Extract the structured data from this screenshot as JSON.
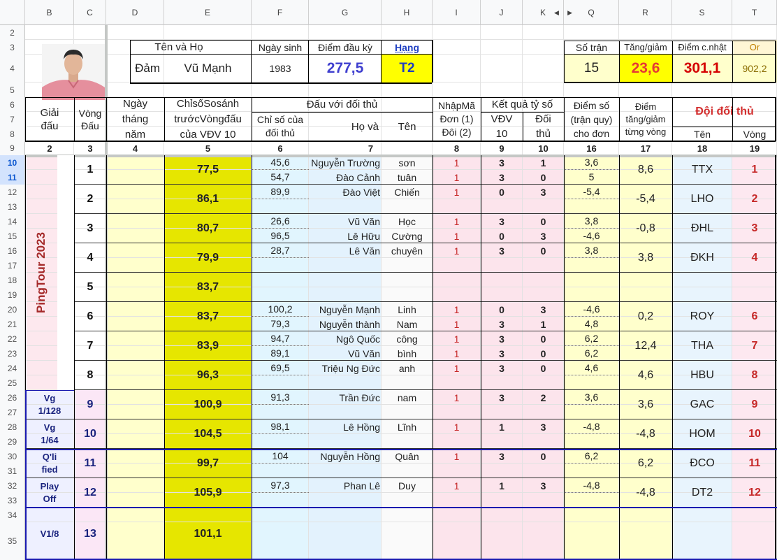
{
  "columns": [
    "B",
    "C",
    "D",
    "E",
    "F",
    "G",
    "H",
    "I",
    "J",
    "K",
    "Q",
    "R",
    "S",
    "T"
  ],
  "rows": [
    "2",
    "3",
    "4",
    "5",
    "6",
    "7",
    "8",
    "9",
    "10",
    "11",
    "12",
    "13",
    "14",
    "15",
    "16",
    "17",
    "18",
    "19",
    "20",
    "21",
    "22",
    "23",
    "24",
    "25",
    "26",
    "27",
    "28",
    "29",
    "30",
    "31",
    "32",
    "33",
    "34",
    "35"
  ],
  "player": {
    "name_header": "Tên    và    Họ",
    "birth_header": "Ngày sinh",
    "start_points_header": "Điểm đầu kỳ",
    "rank_header": "Hạng",
    "first_name": "Đảm",
    "last_name": "Vũ Mạnh",
    "birth": "1983",
    "start_points": "277,5",
    "rank": "T2",
    "photo_icon": "player-photo"
  },
  "summary": {
    "matches_header": "Số trận",
    "change_header": "Tăng/giảm",
    "updated_header": "Điểm c.nhật",
    "or_header": "Or",
    "matches": "15",
    "change": "23,6",
    "updated": "301,1",
    "or_value": "902,2"
  },
  "headers": {
    "tournament": "Giải đấu",
    "round": "Vòng Đấu",
    "date": "Ngày tháng năm",
    "index": "ChỉsốSosánh trướcVòngđấu của VĐV 10",
    "vs_opponent": "Đấu với đối thủ",
    "opp_index": "Chỉ số của đối thủ",
    "opp_last": "Họ    và",
    "opp_first": "Tên",
    "entry_code": "NhậpMã Đơn (1) Đôi (2)",
    "result": "Kết quả tỷ số",
    "vdv10": "VĐV 10",
    "opponent": "Đối thủ",
    "score": "Điểm số (trận quy) cho đơn",
    "change": "Điểm tăng/giảm từng vòng",
    "opp_team": "Đội đối thủ",
    "team_name": "Tên",
    "team_round": "Vòng",
    "num_b": "2",
    "num_c": "3",
    "num_d": "4",
    "num_e": "5",
    "num_f": "6",
    "num_g": "7",
    "num_h": "8",
    "num_i": "9",
    "num_j": "10",
    "num_k": "16",
    "num_q": "17",
    "num_r": "18",
    "num_s": "19"
  },
  "tournament_label": "PingTour 2023",
  "stages": [
    {
      "label": "Vg 1/128"
    },
    {
      "label": "Vg 1/64"
    },
    {
      "label": "Q'li fied"
    },
    {
      "label": "Play Off"
    },
    {
      "label": "V1/8"
    }
  ],
  "rounds": [
    {
      "no": "1",
      "index": "77,5",
      "change": "8,6",
      "team": "TTX",
      "team_round": "1",
      "matches": [
        {
          "opp_index": "45,6",
          "last": "Nguyễn Trường",
          "first": "sơn",
          "code": "1",
          "vdv": "3",
          "opp": "1",
          "score": "3,6"
        },
        {
          "opp_index": "54,7",
          "last": "Đào Cảnh",
          "first": "tuân",
          "code": "1",
          "vdv": "3",
          "opp": "0",
          "score": "5"
        }
      ]
    },
    {
      "no": "2",
      "index": "86,1",
      "change": "-5,4",
      "team": "LHO",
      "team_round": "2",
      "matches": [
        {
          "opp_index": "89,9",
          "last": "Đào Việt",
          "first": "Chiến",
          "code": "1",
          "vdv": "0",
          "opp": "3",
          "score": "-5,4"
        }
      ]
    },
    {
      "no": "3",
      "index": "80,7",
      "change": "-0,8",
      "team": "ĐHL",
      "team_round": "3",
      "matches": [
        {
          "opp_index": "26,6",
          "last": "Vũ Văn",
          "first": "Học",
          "code": "1",
          "vdv": "3",
          "opp": "0",
          "score": "3,8"
        },
        {
          "opp_index": "96,5",
          "last": "Lê Hữu",
          "first": "Cường",
          "code": "1",
          "vdv": "0",
          "opp": "3",
          "score": "-4,6"
        }
      ]
    },
    {
      "no": "4",
      "index": "79,9",
      "change": "3,8",
      "team": "ĐKH",
      "team_round": "4",
      "matches": [
        {
          "opp_index": "28,7",
          "last": "Lê Văn",
          "first": "chuyên",
          "code": "1",
          "vdv": "3",
          "opp": "0",
          "score": "3,8"
        }
      ]
    },
    {
      "no": "5",
      "index": "83,7",
      "change": "",
      "team": "",
      "team_round": "",
      "matches": []
    },
    {
      "no": "6",
      "index": "83,7",
      "change": "0,2",
      "team": "ROY",
      "team_round": "6",
      "matches": [
        {
          "opp_index": "100,2",
          "last": "Nguyễn Mạnh",
          "first": "Linh",
          "code": "1",
          "vdv": "0",
          "opp": "3",
          "score": "-4,6"
        },
        {
          "opp_index": "79,3",
          "last": "Nguyễn thành",
          "first": "Nam",
          "code": "1",
          "vdv": "3",
          "opp": "1",
          "score": "4,8"
        }
      ]
    },
    {
      "no": "7",
      "index": "83,9",
      "change": "12,4",
      "team": "THA",
      "team_round": "7",
      "matches": [
        {
          "opp_index": "94,7",
          "last": "Ngô Quốc",
          "first": "công",
          "code": "1",
          "vdv": "3",
          "opp": "0",
          "score": "6,2"
        },
        {
          "opp_index": "89,1",
          "last": "Vũ Văn",
          "first": "bình",
          "code": "1",
          "vdv": "3",
          "opp": "0",
          "score": "6,2"
        }
      ]
    },
    {
      "no": "8",
      "index": "96,3",
      "change": "4,6",
      "team": "HBU",
      "team_round": "8",
      "matches": [
        {
          "opp_index": "69,5",
          "last": "Triệu Ng Đức",
          "first": "anh",
          "code": "1",
          "vdv": "3",
          "opp": "0",
          "score": "4,6"
        }
      ]
    },
    {
      "no": "9",
      "index": "100,9",
      "change": "3,6",
      "team": "GAC",
      "team_round": "9",
      "matches": [
        {
          "opp_index": "91,3",
          "last": "Trần Đức",
          "first": "nam",
          "code": "1",
          "vdv": "3",
          "opp": "2",
          "score": "3,6"
        }
      ]
    },
    {
      "no": "10",
      "index": "104,5",
      "change": "-4,8",
      "team": "HOM",
      "team_round": "10",
      "matches": [
        {
          "opp_index": "98,1",
          "last": "Lê Hồng",
          "first": "Lĩnh",
          "code": "1",
          "vdv": "1",
          "opp": "3",
          "score": "-4,8"
        }
      ]
    },
    {
      "no": "11",
      "index": "99,7",
      "change": "6,2",
      "team": "ĐCO",
      "team_round": "11",
      "matches": [
        {
          "opp_index": "104",
          "last": "Nguyễn Hồng",
          "first": "Quân",
          "code": "1",
          "vdv": "3",
          "opp": "0",
          "score": "6,2"
        }
      ]
    },
    {
      "no": "12",
      "index": "105,9",
      "change": "-4,8",
      "team": "DT2",
      "team_round": "12",
      "matches": [
        {
          "opp_index": "97,3",
          "last": "Phan Lê",
          "first": "Duy",
          "code": "1",
          "vdv": "1",
          "opp": "3",
          "score": "-4,8"
        }
      ]
    },
    {
      "no": "13",
      "index": "101,1",
      "change": "",
      "team": "",
      "team_round": "",
      "matches": []
    }
  ],
  "colors": {
    "yellow": "#ffff00",
    "khaki": "#e6e600",
    "light_yellow": "#ffffcc",
    "light_blue": "#e1f5fe",
    "light_pink": "#fce4ec",
    "light_lavender": "#f3e5f5",
    "dark_red": "#a52a2a",
    "blue_number": "#3f3fcf",
    "navy": "#1a237e"
  }
}
